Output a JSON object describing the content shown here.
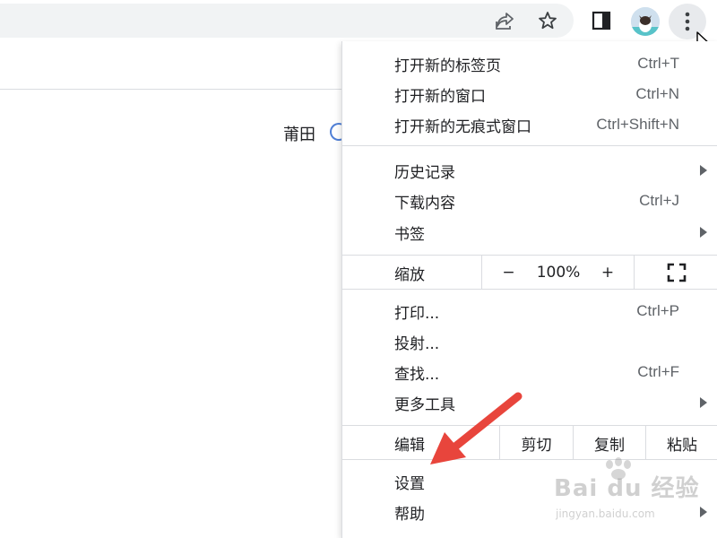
{
  "toolbar": {
    "icons": [
      "share-icon",
      "star-icon",
      "side-panel-icon",
      "profile-avatar",
      "more-menu-icon"
    ]
  },
  "page": {
    "location_text": "莆田"
  },
  "menu": {
    "items_top": [
      {
        "label": "打开新的标签页",
        "shortcut": "Ctrl+T"
      },
      {
        "label": "打开新的窗口",
        "shortcut": "Ctrl+N"
      },
      {
        "label": "打开新的无痕式窗口",
        "shortcut": "Ctrl+Shift+N"
      }
    ],
    "items_history": [
      {
        "label": "历史记录",
        "shortcut": "",
        "submenu": true
      },
      {
        "label": "下载内容",
        "shortcut": "Ctrl+J",
        "submenu": false
      },
      {
        "label": "书签",
        "shortcut": "",
        "submenu": true
      }
    ],
    "zoom": {
      "label": "缩放",
      "minus": "−",
      "value": "100%",
      "plus": "+"
    },
    "items_tools": [
      {
        "label": "打印...",
        "shortcut": "Ctrl+P",
        "submenu": false
      },
      {
        "label": "投射...",
        "shortcut": "",
        "submenu": false
      },
      {
        "label": "查找...",
        "shortcut": "Ctrl+F",
        "submenu": false
      },
      {
        "label": "更多工具",
        "shortcut": "",
        "submenu": true
      }
    ],
    "edit": {
      "label": "编辑",
      "cut": "剪切",
      "copy": "复制",
      "paste": "粘贴"
    },
    "items_bottom": [
      {
        "label": "设置",
        "submenu": false
      },
      {
        "label": "帮助",
        "submenu": true
      }
    ]
  },
  "annotation": {
    "arrow_color": "#e8453c"
  },
  "watermark": {
    "main": "Bai du 经验",
    "sub": "jingyan.baidu.com"
  }
}
